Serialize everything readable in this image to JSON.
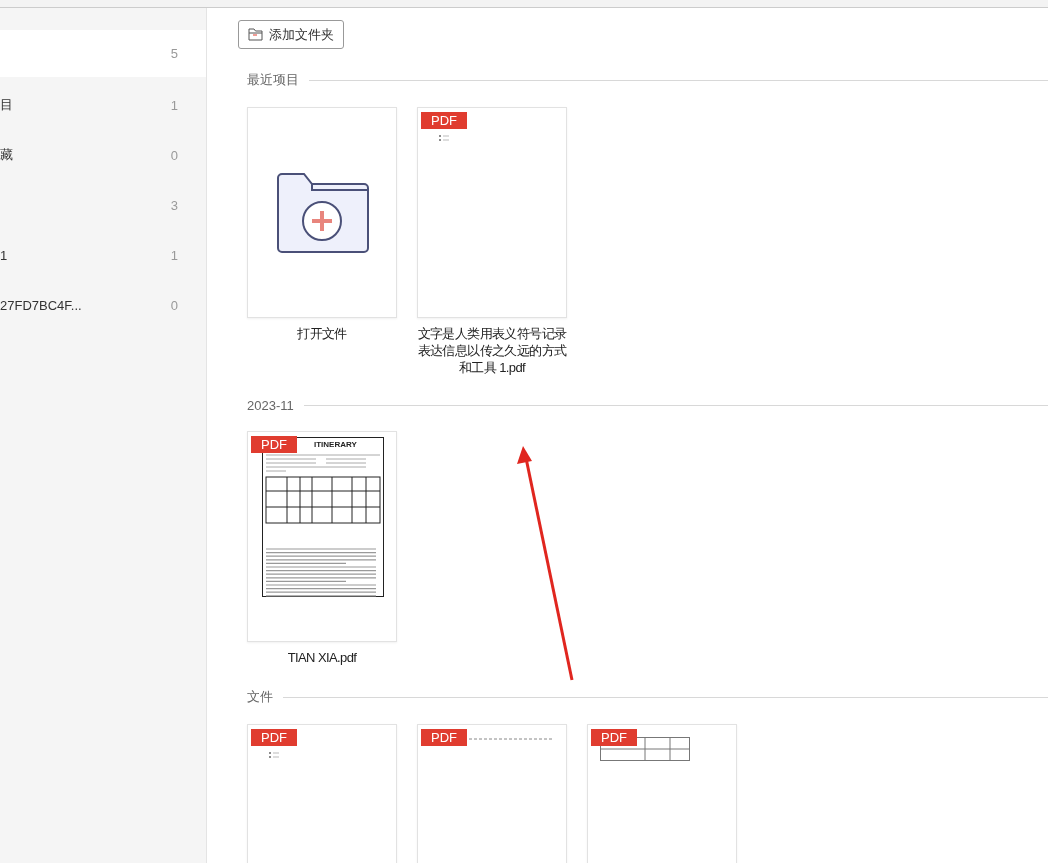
{
  "sidebar": {
    "items": [
      {
        "count": "5",
        "selected": true
      },
      {
        "label": "目",
        "count": "1",
        "selected": false
      },
      {
        "label": "藏",
        "count": "0",
        "selected": false
      },
      {
        "count": "3",
        "selected": false
      },
      {
        "label": "1",
        "count": "1",
        "selected": false
      },
      {
        "label": "27FD7BC4F...",
        "count": "0",
        "selected": false
      }
    ]
  },
  "toolbar": {
    "add_folder_button": "添加文件夹"
  },
  "sections": [
    {
      "title": "最近项目",
      "cards": [
        {
          "kind": "folder-add",
          "caption": "打开文件"
        },
        {
          "badge": "PDF",
          "kind": "bullets",
          "caption": "文字是人类用表义符号记录表达信息以传之久远的方式和工具 1.pdf"
        }
      ]
    },
    {
      "title": "2023-11",
      "cards": [
        {
          "badge": "PDF",
          "kind": "itinerary",
          "heading": "ITINERARY",
          "caption": "TIAN XIA.pdf"
        }
      ]
    },
    {
      "title": "文件",
      "cards": [
        {
          "badge": "PDF",
          "kind": "bullets"
        },
        {
          "badge": "PDF",
          "kind": "text-line"
        },
        {
          "badge": "PDF",
          "kind": "table"
        }
      ]
    }
  ]
}
